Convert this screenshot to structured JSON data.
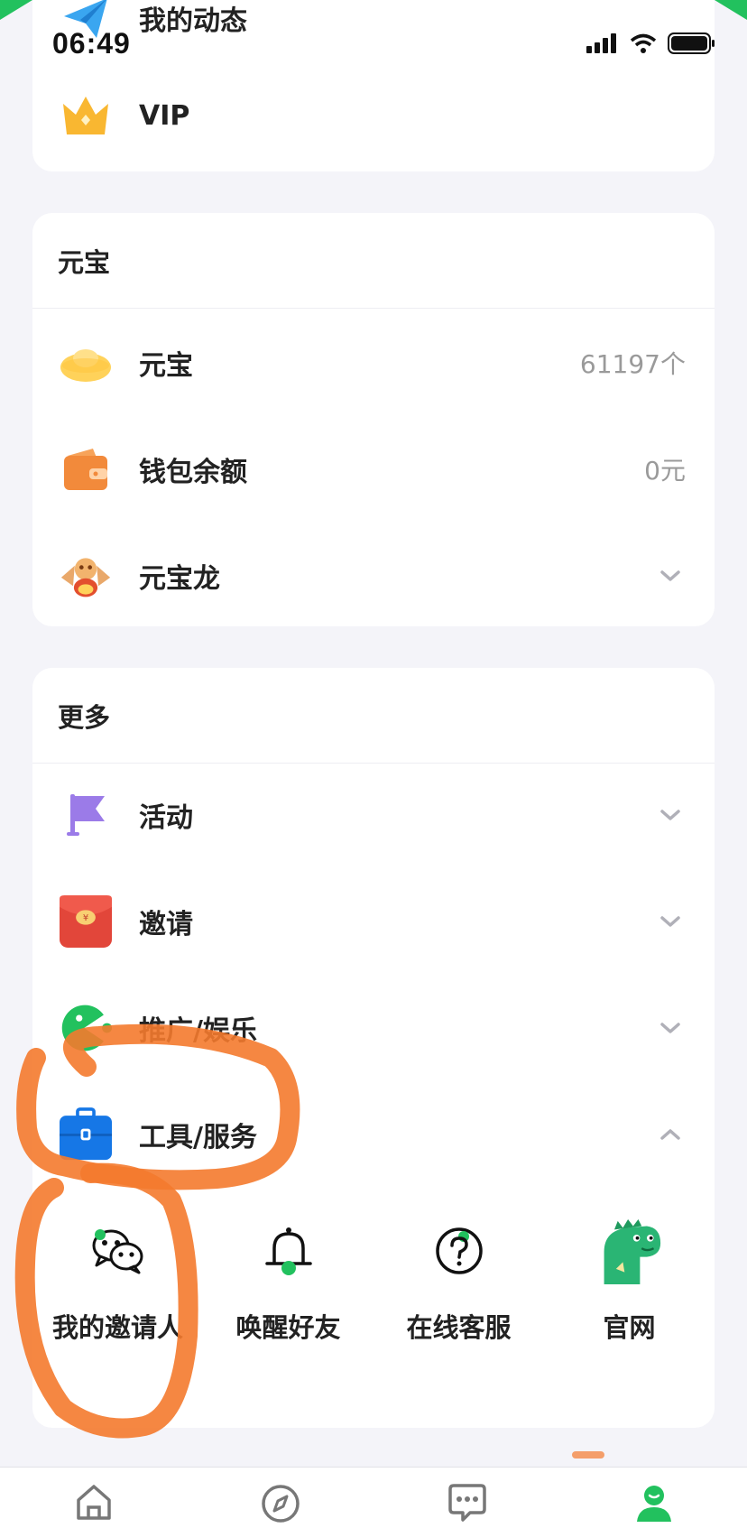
{
  "status_bar": {
    "time": "06:49"
  },
  "top_card": {
    "items": [
      {
        "label": "我的动态",
        "icon": "paper-plane-icon"
      },
      {
        "label": "VIP",
        "icon": "crown-icon"
      }
    ]
  },
  "yuanbao_card": {
    "header": "元宝",
    "items": [
      {
        "label": "元宝",
        "value": "61197个",
        "icon": "gold-ingot-icon"
      },
      {
        "label": "钱包余额",
        "value": "0元",
        "icon": "wallet-icon"
      },
      {
        "label": "元宝龙",
        "icon": "dragon-icon"
      }
    ]
  },
  "more_card": {
    "header": "更多",
    "items": [
      {
        "label": "活动",
        "icon": "flag-icon"
      },
      {
        "label": "邀请",
        "icon": "red-envelope-icon"
      },
      {
        "label": "推广/娱乐",
        "icon": "pacman-icon"
      },
      {
        "label": "工具/服务",
        "icon": "toolbox-icon"
      }
    ],
    "tools": [
      {
        "label": "我的邀请人",
        "icon": "wechat-icon"
      },
      {
        "label": "唤醒好友",
        "icon": "bell-icon"
      },
      {
        "label": "在线客服",
        "icon": "help-circle-icon"
      },
      {
        "label": "官网",
        "icon": "dinosaur-mascot-icon"
      }
    ]
  },
  "tab_bar": {
    "tabs": [
      {
        "icon": "home-icon"
      },
      {
        "icon": "compass-icon"
      },
      {
        "icon": "chat-bubble-icon"
      },
      {
        "icon": "profile-icon",
        "active": true
      }
    ]
  },
  "colors": {
    "brand_green": "#22c15e",
    "annotation_orange": "#f47a2e"
  }
}
